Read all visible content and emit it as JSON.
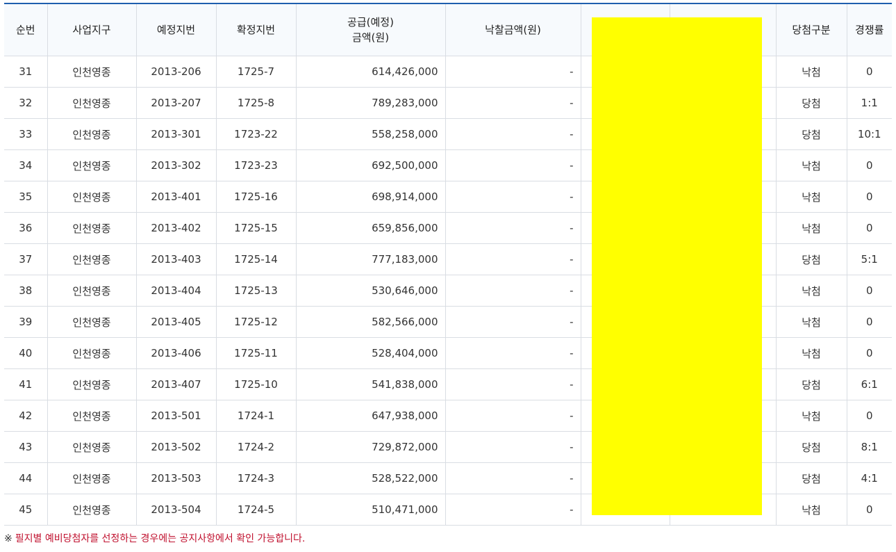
{
  "table": {
    "headers": {
      "seq": "순번",
      "district": "사업지구",
      "planned_lot": "예정지번",
      "confirmed_lot": "확정지번",
      "supply_line1": "공급(예정)",
      "supply_line2": "금액(원)",
      "winning_amount": "낙찰금액(원)",
      "hidden1": "",
      "hidden2": "",
      "result": "당첨구분",
      "competition": "경쟁률"
    },
    "rows": [
      {
        "seq": "31",
        "district": "인천영종",
        "planned": "2013-206",
        "confirmed": "1725-7",
        "supply": "614,426,000",
        "winning": "-",
        "result": "낙첨",
        "competition": "0"
      },
      {
        "seq": "32",
        "district": "인천영종",
        "planned": "2013-207",
        "confirmed": "1725-8",
        "supply": "789,283,000",
        "winning": "-",
        "result": "당첨",
        "competition": "1:1"
      },
      {
        "seq": "33",
        "district": "인천영종",
        "planned": "2013-301",
        "confirmed": "1723-22",
        "supply": "558,258,000",
        "winning": "-",
        "result": "당첨",
        "competition": "10:1"
      },
      {
        "seq": "34",
        "district": "인천영종",
        "planned": "2013-302",
        "confirmed": "1723-23",
        "supply": "692,500,000",
        "winning": "-",
        "result": "낙첨",
        "competition": "0"
      },
      {
        "seq": "35",
        "district": "인천영종",
        "planned": "2013-401",
        "confirmed": "1725-16",
        "supply": "698,914,000",
        "winning": "-",
        "result": "낙첨",
        "competition": "0"
      },
      {
        "seq": "36",
        "district": "인천영종",
        "planned": "2013-402",
        "confirmed": "1725-15",
        "supply": "659,856,000",
        "winning": "-",
        "result": "낙첨",
        "competition": "0"
      },
      {
        "seq": "37",
        "district": "인천영종",
        "planned": "2013-403",
        "confirmed": "1725-14",
        "supply": "777,183,000",
        "winning": "-",
        "result": "당첨",
        "competition": "5:1"
      },
      {
        "seq": "38",
        "district": "인천영종",
        "planned": "2013-404",
        "confirmed": "1725-13",
        "supply": "530,646,000",
        "winning": "-",
        "result": "낙첨",
        "competition": "0"
      },
      {
        "seq": "39",
        "district": "인천영종",
        "planned": "2013-405",
        "confirmed": "1725-12",
        "supply": "582,566,000",
        "winning": "-",
        "result": "낙첨",
        "competition": "0"
      },
      {
        "seq": "40",
        "district": "인천영종",
        "planned": "2013-406",
        "confirmed": "1725-11",
        "supply": "528,404,000",
        "winning": "-",
        "result": "낙첨",
        "competition": "0"
      },
      {
        "seq": "41",
        "district": "인천영종",
        "planned": "2013-407",
        "confirmed": "1725-10",
        "supply": "541,838,000",
        "winning": "-",
        "result": "당첨",
        "competition": "6:1"
      },
      {
        "seq": "42",
        "district": "인천영종",
        "planned": "2013-501",
        "confirmed": "1724-1",
        "supply": "647,938,000",
        "winning": "-",
        "result": "낙첨",
        "competition": "0"
      },
      {
        "seq": "43",
        "district": "인천영종",
        "planned": "2013-502",
        "confirmed": "1724-2",
        "supply": "729,872,000",
        "winning": "-",
        "result": "당첨",
        "competition": "8:1"
      },
      {
        "seq": "44",
        "district": "인천영종",
        "planned": "2013-503",
        "confirmed": "1724-3",
        "supply": "528,522,000",
        "winning": "-",
        "result": "당첨",
        "competition": "4:1"
      },
      {
        "seq": "45",
        "district": "인천영종",
        "planned": "2013-504",
        "confirmed": "1724-5",
        "supply": "510,471,000",
        "winning": "-",
        "result": "낙첨",
        "competition": "0"
      }
    ]
  },
  "note": {
    "mark": "※",
    "text": "필지별 예비당첨자를 선정하는 경우에는 공지사항에서 확인 가능합니다."
  },
  "colors": {
    "header_border": "#1f5fae",
    "redaction": "#ffff00",
    "note_text": "#c0102e"
  }
}
